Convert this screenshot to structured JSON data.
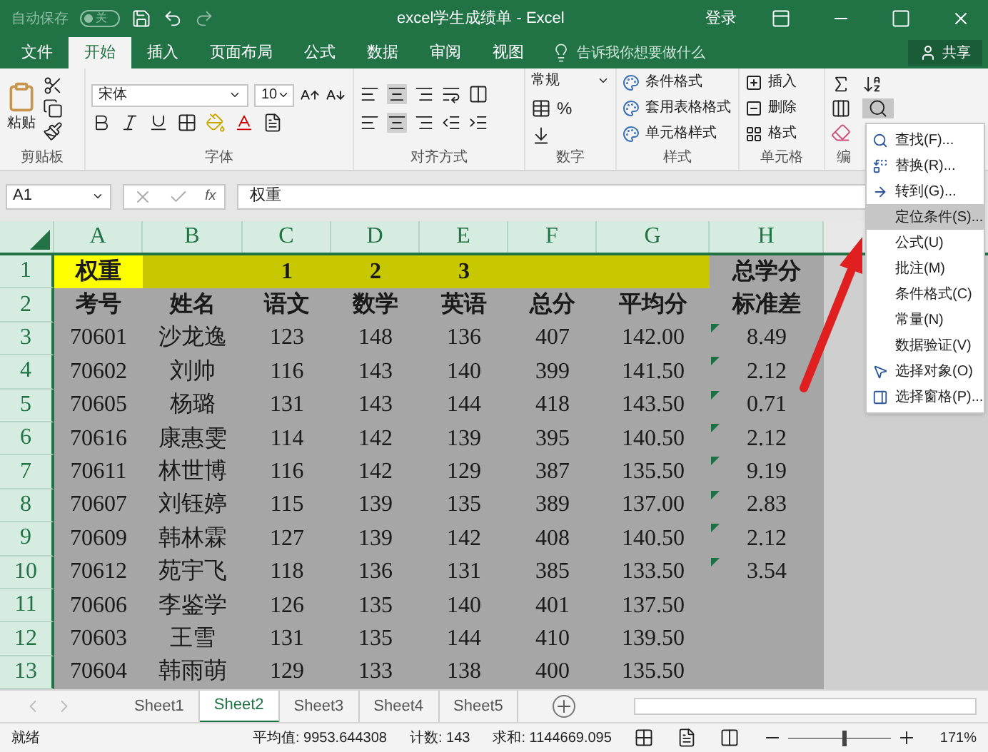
{
  "title_bar": {
    "autosave": {
      "label": "自动保存",
      "state_text": "关",
      "on": false
    },
    "title": "excel学生成绩单  -  Excel",
    "signin": "登录"
  },
  "tabs": [
    {
      "label": "文件",
      "selected": false
    },
    {
      "label": "开始",
      "selected": true
    },
    {
      "label": "插入",
      "selected": false
    },
    {
      "label": "页面布局",
      "selected": false
    },
    {
      "label": "公式",
      "selected": false
    },
    {
      "label": "数据",
      "selected": false
    },
    {
      "label": "审阅",
      "selected": false
    },
    {
      "label": "视图",
      "selected": false
    }
  ],
  "tell_me": {
    "placeholder": "告诉我你想要做什么"
  },
  "share": "共享",
  "ribbon": {
    "clipboard": {
      "paste": "粘贴",
      "label": "剪贴板"
    },
    "font": {
      "name": "宋体",
      "size": "10",
      "label": "字体"
    },
    "alignment": {
      "label": "对齐方式"
    },
    "number": {
      "format": "常规",
      "percent": "%",
      "label": "数字"
    },
    "styles": {
      "items": [
        "条件格式",
        "套用表格格式",
        "单元格样式"
      ],
      "label": "样式"
    },
    "cells": {
      "items": [
        "插入",
        "删除",
        "格式"
      ],
      "label": "单元格"
    },
    "editing": {
      "label": "编"
    }
  },
  "formula_bar": {
    "name_box": "A1",
    "function_label": "fx",
    "value": "权重"
  },
  "columns": [
    "A",
    "B",
    "C",
    "D",
    "E",
    "F",
    "G",
    "H"
  ],
  "rows": [
    {
      "num": "1",
      "cells": [
        {
          "text": "权重",
          "color": "#ffff00"
        },
        {
          "color": "#c8c800"
        },
        {
          "text": "1",
          "color": "#c8c800"
        },
        {
          "text": "2",
          "color": "#c8c800"
        },
        {
          "text": "3",
          "color": "#c8c800"
        },
        {
          "color": "#c8c800"
        },
        {
          "color": "#c8c800"
        },
        {
          "text": "总学分",
          "color": "#a6a6a6"
        }
      ]
    },
    {
      "num": "2",
      "cells": [
        {
          "text": "考号"
        },
        {
          "text": "姓名"
        },
        {
          "text": "语文"
        },
        {
          "text": "数学"
        },
        {
          "text": "英语"
        },
        {
          "text": "总分"
        },
        {
          "text": "平均分"
        },
        {
          "text": "标准差"
        }
      ]
    },
    {
      "num": "3",
      "cells": [
        {
          "text": "70601"
        },
        {
          "text": "沙龙逸"
        },
        {
          "text": "123"
        },
        {
          "text": "148"
        },
        {
          "text": "136"
        },
        {
          "text": "407"
        },
        {
          "text": "142.00"
        },
        {
          "text": "8.49",
          "flag": true
        }
      ]
    },
    {
      "num": "4",
      "cells": [
        {
          "text": "70602"
        },
        {
          "text": "刘帅"
        },
        {
          "text": "116"
        },
        {
          "text": "143"
        },
        {
          "text": "140"
        },
        {
          "text": "399"
        },
        {
          "text": "141.50"
        },
        {
          "text": "2.12",
          "flag": true
        }
      ]
    },
    {
      "num": "5",
      "cells": [
        {
          "text": "70605"
        },
        {
          "text": "杨璐"
        },
        {
          "text": "131"
        },
        {
          "text": "143"
        },
        {
          "text": "144"
        },
        {
          "text": "418"
        },
        {
          "text": "143.50"
        },
        {
          "text": "0.71",
          "flag": true
        }
      ]
    },
    {
      "num": "6",
      "cells": [
        {
          "text": "70616"
        },
        {
          "text": "康惠雯"
        },
        {
          "text": "114"
        },
        {
          "text": "142"
        },
        {
          "text": "139"
        },
        {
          "text": "395"
        },
        {
          "text": "140.50"
        },
        {
          "text": "2.12",
          "flag": true
        }
      ]
    },
    {
      "num": "7",
      "cells": [
        {
          "text": "70611"
        },
        {
          "text": "林世博"
        },
        {
          "text": "116"
        },
        {
          "text": "142"
        },
        {
          "text": "129"
        },
        {
          "text": "387"
        },
        {
          "text": "135.50"
        },
        {
          "text": "9.19",
          "flag": true
        }
      ]
    },
    {
      "num": "8",
      "cells": [
        {
          "text": "70607"
        },
        {
          "text": "刘钰婷"
        },
        {
          "text": "115"
        },
        {
          "text": "139"
        },
        {
          "text": "135"
        },
        {
          "text": "389"
        },
        {
          "text": "137.00"
        },
        {
          "text": "2.83",
          "flag": true
        }
      ]
    },
    {
      "num": "9",
      "cells": [
        {
          "text": "70609"
        },
        {
          "text": "韩林霖"
        },
        {
          "text": "127"
        },
        {
          "text": "139"
        },
        {
          "text": "142"
        },
        {
          "text": "408"
        },
        {
          "text": "140.50"
        },
        {
          "text": "2.12",
          "flag": true
        }
      ]
    },
    {
      "num": "10",
      "cells": [
        {
          "text": "70612"
        },
        {
          "text": "苑宇飞"
        },
        {
          "text": "118"
        },
        {
          "text": "136"
        },
        {
          "text": "131"
        },
        {
          "text": "385"
        },
        {
          "text": "133.50"
        },
        {
          "text": "3.54",
          "flag": true
        }
      ]
    },
    {
      "num": "11",
      "cells": [
        {
          "text": "70606"
        },
        {
          "text": "李鉴学"
        },
        {
          "text": "126"
        },
        {
          "text": "135"
        },
        {
          "text": "140"
        },
        {
          "text": "401"
        },
        {
          "text": "137.50"
        },
        {}
      ]
    },
    {
      "num": "12",
      "cells": [
        {
          "text": "70603"
        },
        {
          "text": "王雪"
        },
        {
          "text": "131"
        },
        {
          "text": "135"
        },
        {
          "text": "144"
        },
        {
          "text": "410"
        },
        {
          "text": "139.50"
        },
        {}
      ]
    },
    {
      "num": "13",
      "cells": [
        {
          "text": "70604"
        },
        {
          "text": "韩雨萌"
        },
        {
          "text": "129"
        },
        {
          "text": "133"
        },
        {
          "text": "138"
        },
        {
          "text": "400"
        },
        {
          "text": "135.50"
        },
        {}
      ]
    }
  ],
  "menu": [
    {
      "label": "查找(F)...",
      "kind": "find",
      "selected": false
    },
    {
      "label": "替换(R)...",
      "kind": "replace",
      "selected": false
    },
    {
      "label": "转到(G)...",
      "kind": "goto",
      "selected": false
    },
    {
      "label": "定位条件(S)...",
      "kind": "plain",
      "selected": true
    },
    {
      "label": "公式(U)",
      "kind": "plain",
      "selected": false
    },
    {
      "label": "批注(M)",
      "kind": "plain",
      "selected": false
    },
    {
      "label": "条件格式(C)",
      "kind": "plain",
      "selected": false
    },
    {
      "label": "常量(N)",
      "kind": "plain",
      "selected": false
    },
    {
      "label": "数据验证(V)",
      "kind": "plain",
      "selected": false
    },
    {
      "label": "选择对象(O)",
      "kind": "pointer",
      "selected": false
    },
    {
      "label": "选择窗格(P)...",
      "kind": "pane",
      "selected": false
    }
  ],
  "sheets": [
    {
      "label": "Sheet1",
      "selected": false
    },
    {
      "label": "Sheet2",
      "selected": true
    },
    {
      "label": "Sheet3",
      "selected": false
    },
    {
      "label": "Sheet4",
      "selected": false
    },
    {
      "label": "Sheet5",
      "selected": false
    }
  ],
  "status_bar": {
    "ready": "就绪",
    "average": "平均值: 9953.644308",
    "count": "计数: 143",
    "sum": "求和: 1144669.095",
    "zoom": "171%",
    "zoom_slider": {
      "level": 0.55
    }
  }
}
